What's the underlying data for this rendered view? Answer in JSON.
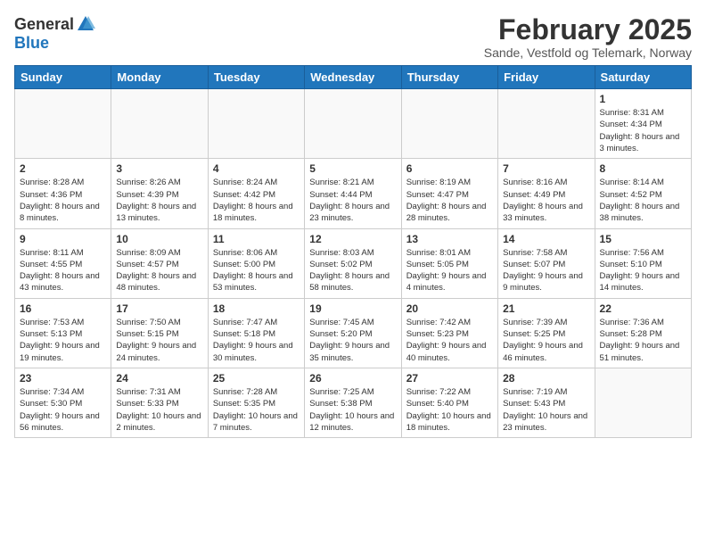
{
  "logo": {
    "general": "General",
    "blue": "Blue"
  },
  "header": {
    "month": "February 2025",
    "location": "Sande, Vestfold og Telemark, Norway"
  },
  "weekdays": [
    "Sunday",
    "Monday",
    "Tuesday",
    "Wednesday",
    "Thursday",
    "Friday",
    "Saturday"
  ],
  "weeks": [
    [
      {
        "day": "",
        "info": ""
      },
      {
        "day": "",
        "info": ""
      },
      {
        "day": "",
        "info": ""
      },
      {
        "day": "",
        "info": ""
      },
      {
        "day": "",
        "info": ""
      },
      {
        "day": "",
        "info": ""
      },
      {
        "day": "1",
        "info": "Sunrise: 8:31 AM\nSunset: 4:34 PM\nDaylight: 8 hours and 3 minutes."
      }
    ],
    [
      {
        "day": "2",
        "info": "Sunrise: 8:28 AM\nSunset: 4:36 PM\nDaylight: 8 hours and 8 minutes."
      },
      {
        "day": "3",
        "info": "Sunrise: 8:26 AM\nSunset: 4:39 PM\nDaylight: 8 hours and 13 minutes."
      },
      {
        "day": "4",
        "info": "Sunrise: 8:24 AM\nSunset: 4:42 PM\nDaylight: 8 hours and 18 minutes."
      },
      {
        "day": "5",
        "info": "Sunrise: 8:21 AM\nSunset: 4:44 PM\nDaylight: 8 hours and 23 minutes."
      },
      {
        "day": "6",
        "info": "Sunrise: 8:19 AM\nSunset: 4:47 PM\nDaylight: 8 hours and 28 minutes."
      },
      {
        "day": "7",
        "info": "Sunrise: 8:16 AM\nSunset: 4:49 PM\nDaylight: 8 hours and 33 minutes."
      },
      {
        "day": "8",
        "info": "Sunrise: 8:14 AM\nSunset: 4:52 PM\nDaylight: 8 hours and 38 minutes."
      }
    ],
    [
      {
        "day": "9",
        "info": "Sunrise: 8:11 AM\nSunset: 4:55 PM\nDaylight: 8 hours and 43 minutes."
      },
      {
        "day": "10",
        "info": "Sunrise: 8:09 AM\nSunset: 4:57 PM\nDaylight: 8 hours and 48 minutes."
      },
      {
        "day": "11",
        "info": "Sunrise: 8:06 AM\nSunset: 5:00 PM\nDaylight: 8 hours and 53 minutes."
      },
      {
        "day": "12",
        "info": "Sunrise: 8:03 AM\nSunset: 5:02 PM\nDaylight: 8 hours and 58 minutes."
      },
      {
        "day": "13",
        "info": "Sunrise: 8:01 AM\nSunset: 5:05 PM\nDaylight: 9 hours and 4 minutes."
      },
      {
        "day": "14",
        "info": "Sunrise: 7:58 AM\nSunset: 5:07 PM\nDaylight: 9 hours and 9 minutes."
      },
      {
        "day": "15",
        "info": "Sunrise: 7:56 AM\nSunset: 5:10 PM\nDaylight: 9 hours and 14 minutes."
      }
    ],
    [
      {
        "day": "16",
        "info": "Sunrise: 7:53 AM\nSunset: 5:13 PM\nDaylight: 9 hours and 19 minutes."
      },
      {
        "day": "17",
        "info": "Sunrise: 7:50 AM\nSunset: 5:15 PM\nDaylight: 9 hours and 24 minutes."
      },
      {
        "day": "18",
        "info": "Sunrise: 7:47 AM\nSunset: 5:18 PM\nDaylight: 9 hours and 30 minutes."
      },
      {
        "day": "19",
        "info": "Sunrise: 7:45 AM\nSunset: 5:20 PM\nDaylight: 9 hours and 35 minutes."
      },
      {
        "day": "20",
        "info": "Sunrise: 7:42 AM\nSunset: 5:23 PM\nDaylight: 9 hours and 40 minutes."
      },
      {
        "day": "21",
        "info": "Sunrise: 7:39 AM\nSunset: 5:25 PM\nDaylight: 9 hours and 46 minutes."
      },
      {
        "day": "22",
        "info": "Sunrise: 7:36 AM\nSunset: 5:28 PM\nDaylight: 9 hours and 51 minutes."
      }
    ],
    [
      {
        "day": "23",
        "info": "Sunrise: 7:34 AM\nSunset: 5:30 PM\nDaylight: 9 hours and 56 minutes."
      },
      {
        "day": "24",
        "info": "Sunrise: 7:31 AM\nSunset: 5:33 PM\nDaylight: 10 hours and 2 minutes."
      },
      {
        "day": "25",
        "info": "Sunrise: 7:28 AM\nSunset: 5:35 PM\nDaylight: 10 hours and 7 minutes."
      },
      {
        "day": "26",
        "info": "Sunrise: 7:25 AM\nSunset: 5:38 PM\nDaylight: 10 hours and 12 minutes."
      },
      {
        "day": "27",
        "info": "Sunrise: 7:22 AM\nSunset: 5:40 PM\nDaylight: 10 hours and 18 minutes."
      },
      {
        "day": "28",
        "info": "Sunrise: 7:19 AM\nSunset: 5:43 PM\nDaylight: 10 hours and 23 minutes."
      },
      {
        "day": "",
        "info": ""
      }
    ]
  ]
}
